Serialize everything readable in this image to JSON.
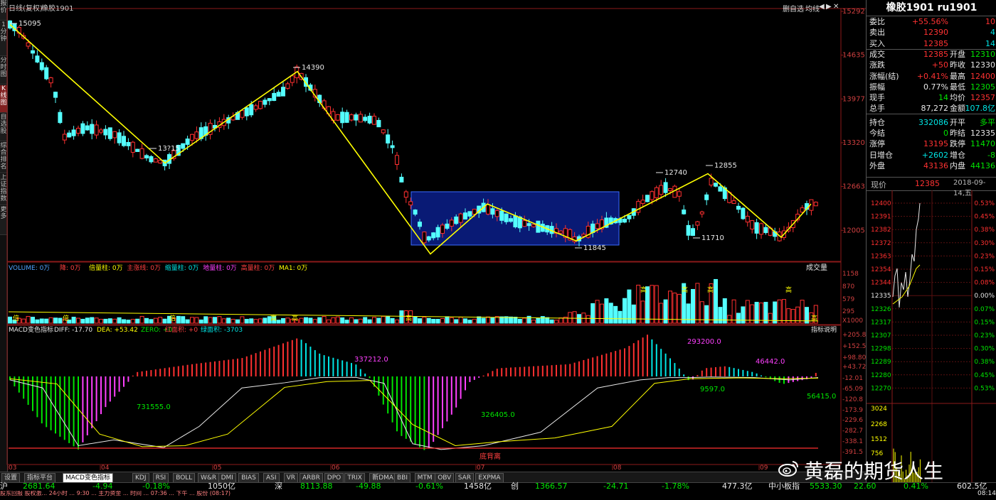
{
  "header": {
    "period_label": "日线(复权)",
    "symbol_label": "橡胶1901",
    "buttons": [
      "删自选",
      "均线",
      "◀",
      "▶",
      "✕"
    ]
  },
  "left_bar": [
    "报价",
    "1分钟",
    "分时图",
    "K线图",
    "自选股",
    "综合排名",
    "上证指数",
    "更多"
  ],
  "price_axis": [
    "15292",
    "14635",
    "13977",
    "13320",
    "12663",
    "12005"
  ],
  "annotations": {
    "p1": "15095",
    "p2": "14390",
    "p3": "13?15",
    "p4": "12740",
    "p5": "12855",
    "p6": "11710",
    "p7": "11845"
  },
  "volume_panel": {
    "legend": [
      {
        "text": "VOLUME: 0万",
        "color": "#4fa3ff"
      },
      {
        "text": "降: 0万",
        "color": "#ff4040"
      },
      {
        "text": "倍量柱: 0万",
        "color": "#ffff00"
      },
      {
        "text": "主涨线: 0万",
        "color": "#ff4040"
      },
      {
        "text": "缩量柱: 0万",
        "color": "#00e5e5"
      },
      {
        "text": "地量柱: 0万",
        "color": "#ff40ff"
      },
      {
        "text": "高量柱: 0万",
        "color": "#ff4040"
      },
      {
        "text": "MA1: 0万",
        "color": "#ffff00"
      }
    ],
    "right_btn": "成交量",
    "axis": [
      "1158",
      "870",
      "579",
      "295",
      "X1000"
    ]
  },
  "macd_panel": {
    "legend_name": "MACD变色指标",
    "diff": "DIFF: -17.70",
    "dea": "DEA: +53.42",
    "zero": "ZERO: +0",
    "red_area": "红面积: +0",
    "green_area": "绿面积: -3703",
    "help_btn": "指标说明",
    "axis": [
      "+205.8",
      "+152.5",
      "+98.80",
      "+43.72",
      "-12.01",
      "-65.09",
      "-120.8",
      "-173.9",
      "-229.6",
      "-282.7",
      "-338.1",
      "-391.5"
    ],
    "labels": [
      {
        "text": "337212.0",
        "color": "#ff40ff"
      },
      {
        "text": "293200.0",
        "color": "#ff40ff"
      },
      {
        "text": "46442.0",
        "color": "#ff40ff"
      },
      {
        "text": "731555.0",
        "color": "#00e600"
      },
      {
        "text": "326405.0",
        "color": "#00e600"
      },
      {
        "text": "9597.0",
        "color": "#00e600"
      },
      {
        "text": "56415.0",
        "color": "#00e600"
      },
      {
        "text": "底背离",
        "color": "#ff4040"
      }
    ]
  },
  "month_axis": [
    "03",
    "04",
    "05",
    "06",
    "07",
    "08",
    "09"
  ],
  "vol_marks": [
    "倍",
    "倍",
    "倍",
    "高",
    "高",
    "高",
    "高",
    "高",
    "高",
    "高",
    "高"
  ],
  "tabs": [
    "设置",
    "指标平台",
    "MACD变色指标",
    "KDJ",
    "RSI",
    "BOLL",
    "W&R",
    "DMI",
    "BIAS",
    "ASI",
    "VR",
    "ARBR",
    "DPO",
    "TRIX",
    "新DMA",
    "BBI",
    "MTM",
    "OBV",
    "SAR",
    "EXPMA"
  ],
  "right_panel": {
    "title": "橡胶1901 ru1901",
    "rows": [
      {
        "l1": "委比",
        "v1": "+55.56%",
        "v1c": "red",
        "l2": "",
        "v2": "10",
        "v2c": "red"
      },
      {
        "l1": "卖出",
        "v1": "12390",
        "v1c": "red",
        "l2": "",
        "v2": "4",
        "v2c": "cyan"
      },
      {
        "l1": "买入",
        "v1": "12385",
        "v1c": "red",
        "l2": "",
        "v2": "14",
        "v2c": "cyan"
      },
      {
        "l1": "成交",
        "v1": "12385",
        "v1c": "red",
        "l2": "开盘",
        "v2": "12310",
        "v2c": "green"
      },
      {
        "l1": "涨跌",
        "v1": "+50",
        "v1c": "red",
        "l2": "昨收",
        "v2": "12330",
        "v2c": "white"
      },
      {
        "l1": "涨幅(结)",
        "v1": "+0.41%",
        "v1c": "red",
        "l2": "最高",
        "v2": "12400",
        "v2c": "red"
      },
      {
        "l1": "振幅",
        "v1": "0.77%",
        "v1c": "white",
        "l2": "最低",
        "v2": "12305",
        "v2c": "green"
      },
      {
        "l1": "现手",
        "v1": "14",
        "v1c": "green",
        "l2": "均价",
        "v2": "12357",
        "v2c": "red"
      },
      {
        "l1": "总手",
        "v1": "87,272",
        "v1c": "white",
        "l2": "金额",
        "v2": "107.8亿",
        "v2c": "cyan"
      },
      {
        "l1": "持仓",
        "v1": "332086",
        "v1c": "cyan",
        "l2": "开平",
        "v2": "多平",
        "v2c": "green"
      },
      {
        "l1": "今结",
        "v1": "0",
        "v1c": "green",
        "l2": "昨结",
        "v2": "12335",
        "v2c": "white"
      },
      {
        "l1": "涨停",
        "v1": "13195",
        "v1c": "red",
        "l2": "跌停",
        "v2": "11470",
        "v2c": "green"
      },
      {
        "l1": "日增仓",
        "v1": "+2602",
        "v1c": "cyan",
        "l2": "增仓",
        "v2": "-8",
        "v2c": "green"
      },
      {
        "l1": "外盘",
        "v1": "43136",
        "v1c": "red",
        "l2": "内盘",
        "v2": "44136",
        "v2c": "green"
      }
    ],
    "quote_label": "现价",
    "quote_price": "12385",
    "quote_date": "2018-09-14,五",
    "intraday_left": [
      "12400",
      "12391",
      "12382",
      "12372",
      "12363",
      "12354",
      "12344",
      "12335",
      "12326",
      "12317",
      "12307",
      "12298",
      "12289",
      "12280",
      "12270"
    ],
    "intraday_right": [
      "0.53%",
      "0.45%",
      "0.38%",
      "0.30%",
      "0.23%",
      "0.15%",
      "0.08%",
      "0.00%",
      "0.07%",
      "0.15%",
      "0.23%",
      "0.30%",
      "0.38%",
      "0.45%",
      "0.53%"
    ],
    "intraday_vol": [
      "3024",
      "2268",
      "1512",
      "756"
    ]
  },
  "status_bar": {
    "items": [
      {
        "text": "沪",
        "color": "#e8e8e8"
      },
      {
        "text": "2681.64",
        "color": "#00e600"
      },
      {
        "text": "-4.94",
        "color": "#00e600"
      },
      {
        "text": "-0.18%",
        "color": "#00e600"
      },
      {
        "text": "1050亿",
        "color": "#e8e8e8"
      },
      {
        "text": "深",
        "color": "#e8e8e8"
      },
      {
        "text": "8113.88",
        "color": "#00e600"
      },
      {
        "text": "-49.88",
        "color": "#00e600"
      },
      {
        "text": "-0.61%",
        "color": "#00e600"
      },
      {
        "text": "1458亿",
        "color": "#e8e8e8"
      },
      {
        "text": "创",
        "color": "#e8e8e8"
      },
      {
        "text": "1366.57",
        "color": "#00e600"
      },
      {
        "text": "-24.71",
        "color": "#00e600"
      },
      {
        "text": "-1.78%",
        "color": "#00e600"
      },
      {
        "text": "477.3亿",
        "color": "#e8e8e8"
      },
      {
        "text": "中小板指",
        "color": "#e8e8e8"
      },
      {
        "text": "5533.30",
        "color": "#00e600"
      },
      {
        "text": "22.60",
        "color": "#00e600"
      },
      {
        "text": "0.41%",
        "color": "#00e600"
      },
      {
        "text": "602.5亿",
        "color": "#e8e8e8"
      }
    ],
    "ticker": "股东回报 股权激... 24小时 ... 9:30 ... 主力资金 ... 时间 ... 07:36 ... 下午 ... 股份 (08:17)",
    "clock": "08:14"
  },
  "watermark": "黄磊的期货人生",
  "chart_data": {
    "type": "candlestick",
    "title": "橡胶1901 日线(复权)",
    "price_ylim": [
      11560,
      15292
    ],
    "candles": [],
    "zigzag_points": [
      15095,
      13015,
      14390,
      11650,
      12400,
      11845,
      12855,
      11710,
      12400
    ]
  }
}
